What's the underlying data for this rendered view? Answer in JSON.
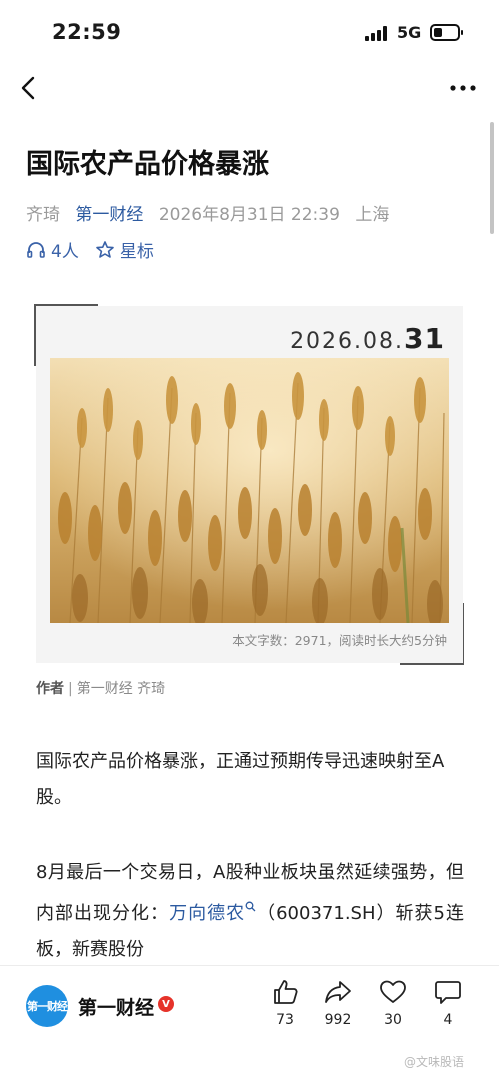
{
  "status_bar": {
    "time": "22:59",
    "network": "5G"
  },
  "article": {
    "title": "国际农产品价格暴涨",
    "author": "齐琦",
    "source": "第一财经",
    "date": "2026年8月31日 22:39",
    "location": "上海",
    "listeners": "4人",
    "star_label": "星标"
  },
  "card": {
    "date_prefix": "2026.08.",
    "date_day": "31",
    "caption": "本文字数：2971，阅读时长大约5分钟"
  },
  "byline": {
    "label": "作者",
    "sep": "|",
    "source": "第一财经",
    "author": "齐琦"
  },
  "paragraphs": {
    "p1": "国际农产品价格暴涨，正通过预期传导迅速映射至A股。",
    "p2_before": "8月最后一个交易日，A股种业板块虽然延续强势，但内部出现分化：",
    "p2_stock": "万向德农",
    "p2_after": "（600371.SH）斩获5连板，新赛股份"
  },
  "bottom_bar": {
    "brand_logo_text": "第一财经",
    "brand_name": "第一财经",
    "verified_badge": "V",
    "like_count": "73",
    "share_count": "992",
    "favorite_count": "30",
    "comment_count": "4",
    "watermark": "@文味股语"
  },
  "colors": {
    "link_blue": "#2c5aa0",
    "brand_blue": "#1f8fe0",
    "badge_red": "#e6332a"
  },
  "icons": [
    "back-arrow-icon",
    "more-dots-icon",
    "headphones-icon",
    "star-icon",
    "search-icon",
    "like-icon",
    "share-icon",
    "heart-icon",
    "comment-icon"
  ]
}
